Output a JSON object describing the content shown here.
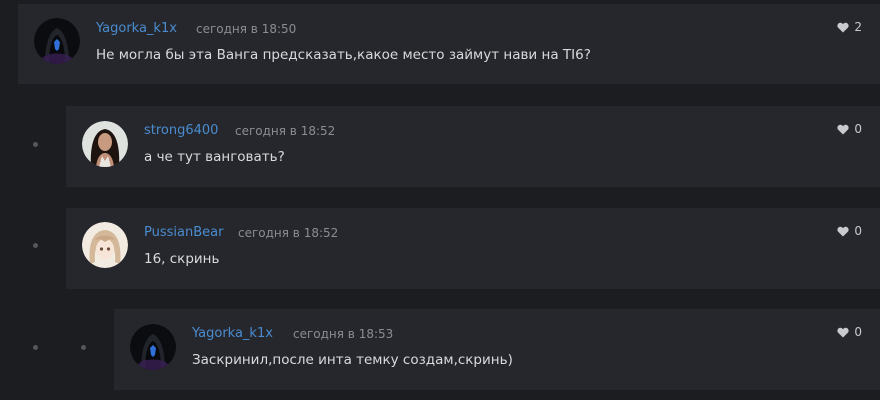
{
  "comments": [
    {
      "author": "Yagorka_k1x",
      "time": "сегодня в 18:50",
      "text": "Не могла бы эта Ванга предсказать,какое место займут нави на TI6?",
      "likes": "2",
      "avatar_icon": "hooded-figure-avatar"
    },
    {
      "author": "strong6400",
      "time": "сегодня в 18:52",
      "text": "а че тут ванговать?",
      "likes": "0",
      "avatar_icon": "woman-portrait-avatar"
    },
    {
      "author": "PussianBear",
      "time": "сегодня в 18:52",
      "text": "16, скринь",
      "likes": "0",
      "avatar_icon": "anime-girl-avatar"
    },
    {
      "author": "Yagorka_k1x",
      "time": "сегодня в 18:53",
      "text": "Заскринил,после инта темку создам,скринь)",
      "likes": "0",
      "avatar_icon": "hooded-figure-avatar"
    }
  ],
  "colors": {
    "page_bg": "#1c1d21",
    "card_bg": "#26272c",
    "author": "#4a8cd0",
    "meta": "#8b8d93",
    "text": "#d9dadc"
  },
  "icons": {
    "like": "heart-icon",
    "thread": "thread-dot"
  }
}
